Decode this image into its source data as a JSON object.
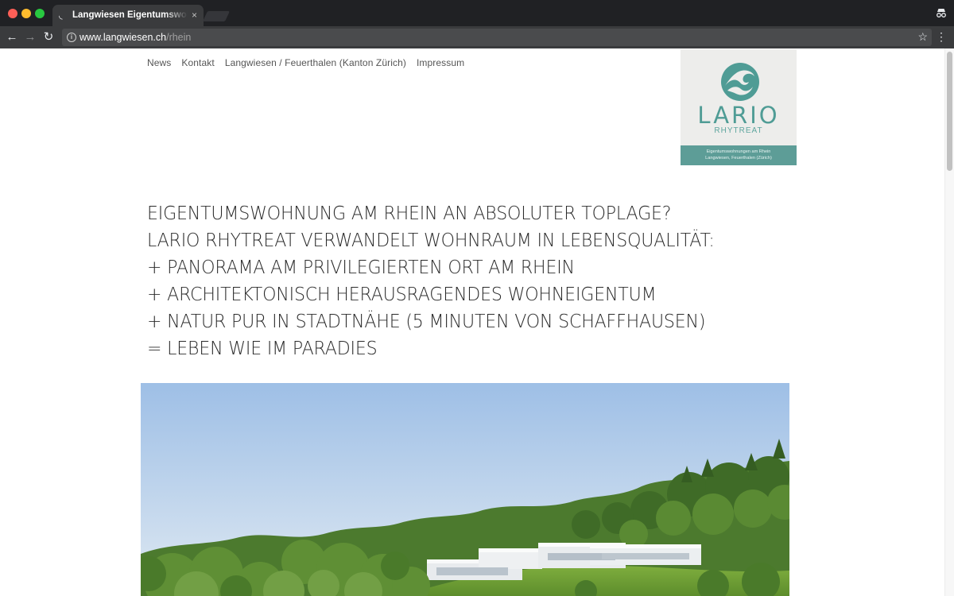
{
  "browser": {
    "tab_title": "Langwiesen Eigentumswohnungen am Rhein",
    "tab_close": "×",
    "url_host": "www.langwiesen.ch",
    "url_path": "/rhein"
  },
  "nav": {
    "items": [
      {
        "label": "News"
      },
      {
        "label": "Kontakt"
      },
      {
        "label": "Langwiesen / Feuerthalen (Kanton Zürich)"
      },
      {
        "label": "Impressum"
      }
    ]
  },
  "logo": {
    "title": "LARIO",
    "subtitle": "RHYTREAT",
    "band_line1": "Eigentumswohnungen am Rhein",
    "band_line2": "Langwiesen, Feuerthalen (Zürich)",
    "accent_color": "#4f9c95"
  },
  "headline": {
    "lines": [
      "EIGENTUMSWOHNUNG AM RHEIN AN ABSOLUTER TOPLAGE?",
      "LARIO RHYTREAT VERWANDELT WOHNRAUM IN LEBENSQUALITÄT:",
      "+ PANORAMA AM PRIVILEGIERTEN ORT AM RHEIN",
      "+ ARCHITEKTONISCH HERAUSRAGENDES WOHNEIGENTUM",
      "+ NATUR PUR IN STADTNÄHE (5 MINUTEN VON SCHAFFHAUSEN)",
      "= LEBEN WIE IM PARADIES"
    ]
  },
  "hero": {
    "image_name": "hillside-residence-rendering",
    "sky_color": "#9ebfe6",
    "foliage_color": "#4c7a2e"
  }
}
